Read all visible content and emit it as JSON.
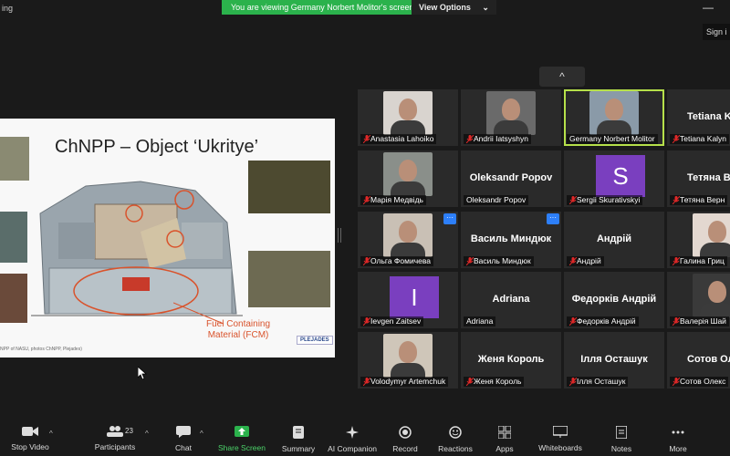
{
  "app": {
    "title_fragment": "ing",
    "minimize": "—"
  },
  "share_banner": {
    "message": "You are viewing Germany Norbert Molitor's screen",
    "view_options": "View Options",
    "dropdown": "⌄"
  },
  "sign_in": "Sign i",
  "slide": {
    "title": "ChNPP – Object ‘Ukritye’",
    "fcm_label": "Fuel Containing\nMaterial (FCM)",
    "credit": "NPP of NASU, photos ChNPP, Plejades)",
    "logo": "PLEJADES"
  },
  "collapse_glyph": "^",
  "participants": [
    {
      "name": "Anastasia Lahoiko",
      "type": "video",
      "muted": true
    },
    {
      "name": "Andrii Iatsyshyn",
      "type": "video",
      "muted": true
    },
    {
      "name": "Germany Norbert Molitor",
      "type": "video",
      "muted": false,
      "active": true
    },
    {
      "name": "Tetiana Kalyn",
      "big": "Tetiana Ka",
      "type": "name",
      "muted": true
    },
    {
      "name": "Марія Медвідь",
      "type": "video",
      "muted": true
    },
    {
      "name": "Oleksandr Popov",
      "big": "Oleksandr Popov",
      "type": "name",
      "muted": false
    },
    {
      "name": "Sergii Skurativskyi",
      "letter": "S",
      "type": "letter",
      "muted": true
    },
    {
      "name": "Тетяна Верн",
      "big": "Тетяна Вер",
      "type": "name",
      "muted": true
    },
    {
      "name": "Ольга Фомичева",
      "type": "video",
      "muted": true,
      "badge": "···"
    },
    {
      "name": "Василь Миндюк",
      "big": "Василь Миндюк",
      "type": "name",
      "muted": true,
      "badge": "···"
    },
    {
      "name": "Андрій",
      "big": "Андрій",
      "type": "name",
      "muted": true
    },
    {
      "name": "Галина Гриц",
      "type": "video",
      "muted": true
    },
    {
      "name": "Ievgen Zaitsev",
      "letter": "I",
      "type": "letter",
      "muted": true
    },
    {
      "name": "Adriana",
      "big": "Adriana",
      "type": "name",
      "muted": false
    },
    {
      "name": "Федорків Андрій",
      "big": "Федорків Андрій",
      "type": "name",
      "muted": true
    },
    {
      "name": "Валерія Шай",
      "type": "video",
      "muted": true
    },
    {
      "name": "Volodymyr Artemchuk",
      "type": "video",
      "muted": true
    },
    {
      "name": "Женя Король",
      "big": "Женя Король",
      "type": "name",
      "muted": true
    },
    {
      "name": "Ілля Осташук",
      "big": "Ілля Осташук",
      "type": "name",
      "muted": true
    },
    {
      "name": "Сотов Олекс",
      "big": "Сотов Оле",
      "type": "name",
      "muted": true
    }
  ],
  "toolbar": {
    "stop_video": "Stop Video",
    "participants": "Participants",
    "participants_count": "23",
    "chat": "Chat",
    "share_screen": "Share Screen",
    "summary": "Summary",
    "ai_companion": "AI Companion",
    "record": "Record",
    "reactions": "Reactions",
    "apps": "Apps",
    "whiteboards": "Whiteboards",
    "notes": "Notes",
    "more": "More"
  },
  "colors": {
    "share_green": "#2bb24c",
    "active_outline": "#b6e04a",
    "mute_red": "#e02828",
    "badge_blue": "#2d7ff9",
    "s_avatar": "#7a3fbf",
    "i_avatar": "#7a3fbf"
  }
}
